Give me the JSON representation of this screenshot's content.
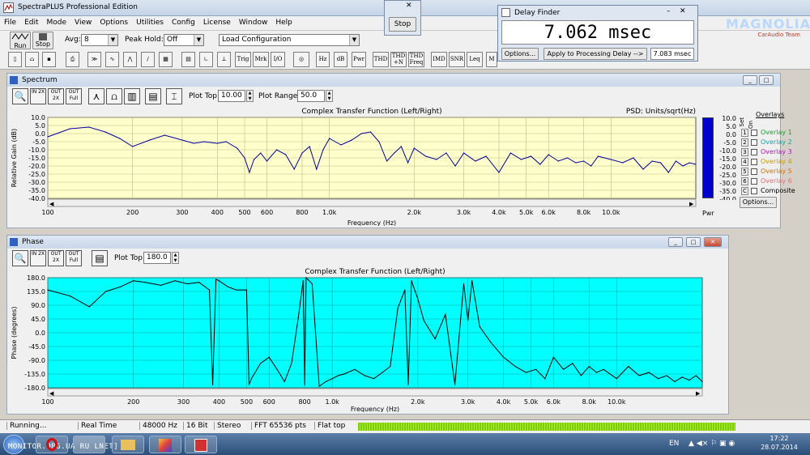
{
  "app": {
    "title": "SpectraPLUS Professional Edition"
  },
  "menu": [
    "File",
    "Edit",
    "Mode",
    "View",
    "Options",
    "Utilities",
    "Config",
    "License",
    "Window",
    "Help"
  ],
  "toolbar": {
    "run_label": "Run",
    "stop_label": "Stop",
    "avg_label": "Avg:",
    "avg_value": "8",
    "peak_hold_label": "Peak Hold:",
    "peak_hold_value": "Off",
    "config_value": "Load Configuration",
    "tool_buttons": [
      "Hz",
      "dB",
      "Pwr",
      "THD",
      "THD +N",
      "THD Freq",
      "IMD",
      "SNR",
      "Leq",
      "M"
    ],
    "text_buttons": [
      "Trig",
      "Mrk",
      "I/O"
    ]
  },
  "stop_popup": {
    "label": "Stop"
  },
  "delay_finder": {
    "title": "Delay Finder",
    "value": "7.062 msec",
    "options_label": "Options...",
    "apply_label": "Apply to Processing Delay -->",
    "applied_value": "7.083 msec"
  },
  "watermark": {
    "name": "MAGNOLIA",
    "sub": "CarAudio Team"
  },
  "spectrum": {
    "title": "Spectrum",
    "plot_top_label": "Plot Top:",
    "plot_top_value": "10.00",
    "plot_range_label": "Plot Range:",
    "plot_range_value": "50.0",
    "chart_title": "Complex Transfer Function (Left/Right)",
    "psd_label": "PSD: Units/sqrt(Hz)",
    "ylabel": "Relative Gain (dB)",
    "xlabel": "Frequency (Hz)",
    "pwr_label": "Pwr",
    "icon_labels": [
      "IN 2X",
      "OUT 2X",
      "OUT Full"
    ]
  },
  "overlays": {
    "title": "Overlays",
    "set_label": "Set",
    "on_label": "On",
    "items": [
      {
        "num": "1",
        "label": "Overlay 1",
        "color": "#1e9b2e"
      },
      {
        "num": "2",
        "label": "Overlay 2",
        "color": "#1aa0a0"
      },
      {
        "num": "3",
        "label": "Overlay 3",
        "color": "#b01cb0"
      },
      {
        "num": "4",
        "label": "Overlay 4",
        "color": "#c89a00"
      },
      {
        "num": "5",
        "label": "Overlay 5",
        "color": "#d07010"
      },
      {
        "num": "6",
        "label": "Overlay 6",
        "color": "#e07070"
      },
      {
        "num": "C",
        "label": "Composite",
        "color": "#000000"
      }
    ],
    "options_label": "Options..."
  },
  "phase": {
    "title": "Phase",
    "plot_top_label": "Plot Top:",
    "plot_top_value": "180.0",
    "chart_title": "Complex Transfer Function (Left/Right)",
    "ylabel": "Phase (degrees)",
    "xlabel": "Frequency (Hz)"
  },
  "status": {
    "items": [
      "Running...",
      "Real Time",
      "48000 Hz",
      "16 Bit",
      "Stereo",
      "FFT 65536 pts",
      "Flat top"
    ]
  },
  "taskbar": {
    "watermark_text": "MONITOR.ORG.UA RU LNET]",
    "lang": "EN",
    "time": "17:22",
    "date": "28.07.2014"
  },
  "colors": {
    "spectrum_bg": "#ffffcc",
    "spectrum_line": "#0000a0",
    "phase_bg": "#00ffff",
    "phase_line": "#000000",
    "power_bar": "#0000cc",
    "level_meter": "#7fd000"
  },
  "chart_data": [
    {
      "type": "line",
      "title": "Complex Transfer Function (Left/Right)",
      "xlabel": "Frequency (Hz)",
      "ylabel": "Relative Gain (dB)",
      "x_scale": "log",
      "xlim": [
        100,
        20000
      ],
      "ylim": [
        -40,
        10
      ],
      "x_ticks": [
        100,
        200,
        300,
        400,
        500,
        600,
        800,
        1000,
        2000,
        3000,
        4000,
        5000,
        6000,
        8000,
        10000
      ],
      "x_tick_labels": [
        "100",
        "200",
        "300",
        "400",
        "500",
        "600",
        "800",
        "1.0k",
        "2.0k",
        "3.0k",
        "4.0k",
        "5.0k",
        "6.0k",
        "8.0k",
        "10.0k"
      ],
      "y_ticks": [
        10,
        5,
        0,
        -5,
        -10,
        -15,
        -20,
        -25,
        -30,
        -35,
        -40
      ],
      "y_tick_labels": [
        "10.0",
        "5.0",
        "0.0",
        "-5.0",
        "-10.0",
        "-15.0",
        "-20.0",
        "-25.0",
        "-30.0",
        "-35.0",
        "-40.0"
      ],
      "grid": true,
      "series": [
        {
          "x": [
            100,
            120,
            140,
            160,
            180,
            200,
            230,
            260,
            300,
            330,
            360,
            400,
            430,
            470,
            500,
            520,
            540,
            570,
            600,
            650,
            700,
            750,
            800,
            850,
            900,
            950,
            1000,
            1100,
            1200,
            1300,
            1400,
            1500,
            1600,
            1700,
            1800,
            1900,
            2000,
            2200,
            2400,
            2600,
            2800,
            3000,
            3300,
            3600,
            4000,
            4400,
            4800,
            5200,
            5600,
            6000,
            6500,
            7000,
            7500,
            8000,
            8500,
            9000,
            10000,
            11000,
            12000,
            13000,
            14000,
            15000,
            16000,
            17000,
            18000,
            19000,
            20000
          ],
          "y": [
            -2,
            3,
            4,
            1,
            -3,
            -8,
            -4,
            -1,
            -4,
            -6,
            -5,
            -6,
            -5,
            -9,
            -15,
            -24,
            -16,
            -12,
            -17,
            -10,
            -13,
            -22,
            -12,
            -8,
            -22,
            -10,
            -3,
            -7,
            -4,
            0,
            1,
            -5,
            -17,
            -12,
            -8,
            -18,
            -9,
            -14,
            -16,
            -12,
            -20,
            -12,
            -17,
            -14,
            -24,
            -12,
            -16,
            -14,
            -19,
            -13,
            -17,
            -15,
            -18,
            -17,
            -20,
            -14,
            -16,
            -18,
            -15,
            -22,
            -17,
            -18,
            -24,
            -17,
            -20,
            -18,
            -19
          ]
        }
      ]
    },
    {
      "type": "line",
      "title": "Complex Transfer Function (Left/Right)",
      "xlabel": "Frequency (Hz)",
      "ylabel": "Phase (degrees)",
      "x_scale": "log",
      "xlim": [
        100,
        20000
      ],
      "ylim": [
        -180,
        180
      ],
      "x_ticks": [
        100,
        200,
        300,
        400,
        500,
        600,
        800,
        1000,
        2000,
        3000,
        4000,
        5000,
        6000,
        8000,
        10000
      ],
      "x_tick_labels": [
        "100",
        "200",
        "300",
        "400",
        "500",
        "600",
        "800",
        "1.0k",
        "2.0k",
        "3.0k",
        "4.0k",
        "5.0k",
        "6.0k",
        "8.0k",
        "10.0k"
      ],
      "y_ticks": [
        180,
        135,
        90,
        45,
        0,
        -45,
        -90,
        -135,
        -180
      ],
      "y_tick_labels": [
        "180.0",
        "135.0",
        "90.0",
        "45.0",
        "0.0",
        "-45.0",
        "-90.0",
        "-135.0",
        "-180.0"
      ],
      "grid": true,
      "series": [
        {
          "x": [
            100,
            120,
            140,
            160,
            180,
            200,
            220,
            250,
            280,
            310,
            340,
            370,
            380,
            390,
            400,
            430,
            460,
            500,
            510,
            520,
            560,
            600,
            640,
            680,
            720,
            760,
            790,
            800,
            810,
            850,
            900,
            950,
            1000,
            1050,
            1100,
            1200,
            1300,
            1400,
            1500,
            1600,
            1700,
            1800,
            1850,
            1900,
            2000,
            2100,
            2300,
            2500,
            2700,
            2900,
            3000,
            3100,
            3300,
            3600,
            4000,
            4400,
            4800,
            5200,
            5600,
            6000,
            6500,
            7000,
            7500,
            8000,
            8500,
            9000,
            10000,
            11000,
            12000,
            13000,
            14000,
            15000,
            16000,
            17000,
            18000,
            19000,
            20000
          ],
          "y": [
            140,
            120,
            85,
            135,
            150,
            170,
            165,
            155,
            170,
            160,
            165,
            140,
            -170,
            175,
            170,
            150,
            140,
            140,
            -170,
            -150,
            -100,
            -80,
            -120,
            -160,
            -100,
            50,
            170,
            -170,
            180,
            160,
            -175,
            -160,
            -150,
            -140,
            -135,
            -120,
            -140,
            -150,
            -130,
            -110,
            80,
            140,
            -170,
            170,
            110,
            40,
            -20,
            60,
            -170,
            160,
            40,
            170,
            20,
            -30,
            -80,
            -110,
            -130,
            -120,
            -150,
            -80,
            -120,
            -100,
            -140,
            -110,
            -130,
            -120,
            -150,
            -110,
            -140,
            -130,
            -150,
            -140,
            -160,
            -145,
            -155,
            -140,
            -160
          ]
        }
      ]
    }
  ]
}
